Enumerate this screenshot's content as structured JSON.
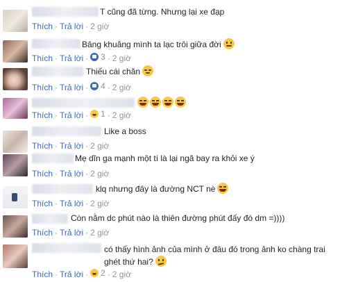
{
  "actions": {
    "like": "Thích",
    "reply": "Trả lời"
  },
  "comments": [
    {
      "text": "T cũng đã từng. Nhưng lại xe đạp",
      "emoji": "",
      "reaction": "",
      "reaction_count": "",
      "time": "2 giờ"
    },
    {
      "text": "Bâng khuâng mình ta lạc trôi giữa đời",
      "emoji": "smile",
      "reaction": "like-icon",
      "reaction_count": "3",
      "time": "2 giờ"
    },
    {
      "text": "Thiếu cái chăn",
      "emoji": "blush",
      "reaction": "like-icon",
      "reaction_count": "4",
      "time": "2 giờ"
    },
    {
      "text": "",
      "emoji": "laugh x4",
      "reaction": "haha-icon",
      "reaction_count": "1",
      "time": "2 giờ"
    },
    {
      "text": "Like a boss",
      "emoji": "",
      "reaction": "",
      "reaction_count": "",
      "time": "2 giờ"
    },
    {
      "text": "Mẹ dĩn ga mạnh một tí là lại ngã bay ra khỏi xe ý",
      "emoji": "",
      "reaction": "",
      "reaction_count": "",
      "time": "2 giờ"
    },
    {
      "text": "klq nhưng đây là đường NCT nè",
      "emoji": "laugh",
      "reaction": "",
      "reaction_count": "",
      "time": "2 giờ"
    },
    {
      "text": "Còn nằm dc phút nào là thiên đường phút đấy đó dm =))))",
      "emoji": "",
      "reaction": "",
      "reaction_count": "",
      "time": "2 giờ"
    },
    {
      "text": "có thấy hình ảnh của mình ở đâu đó trong ảnh ko chàng trai ghét thứ hai?",
      "emoji": "confused",
      "reaction": "haha-icon",
      "reaction_count": "2",
      "time": "2 giờ"
    }
  ],
  "colors": {
    "link": "#4267b2",
    "meta": "#90949c",
    "text": "#1d2129"
  }
}
